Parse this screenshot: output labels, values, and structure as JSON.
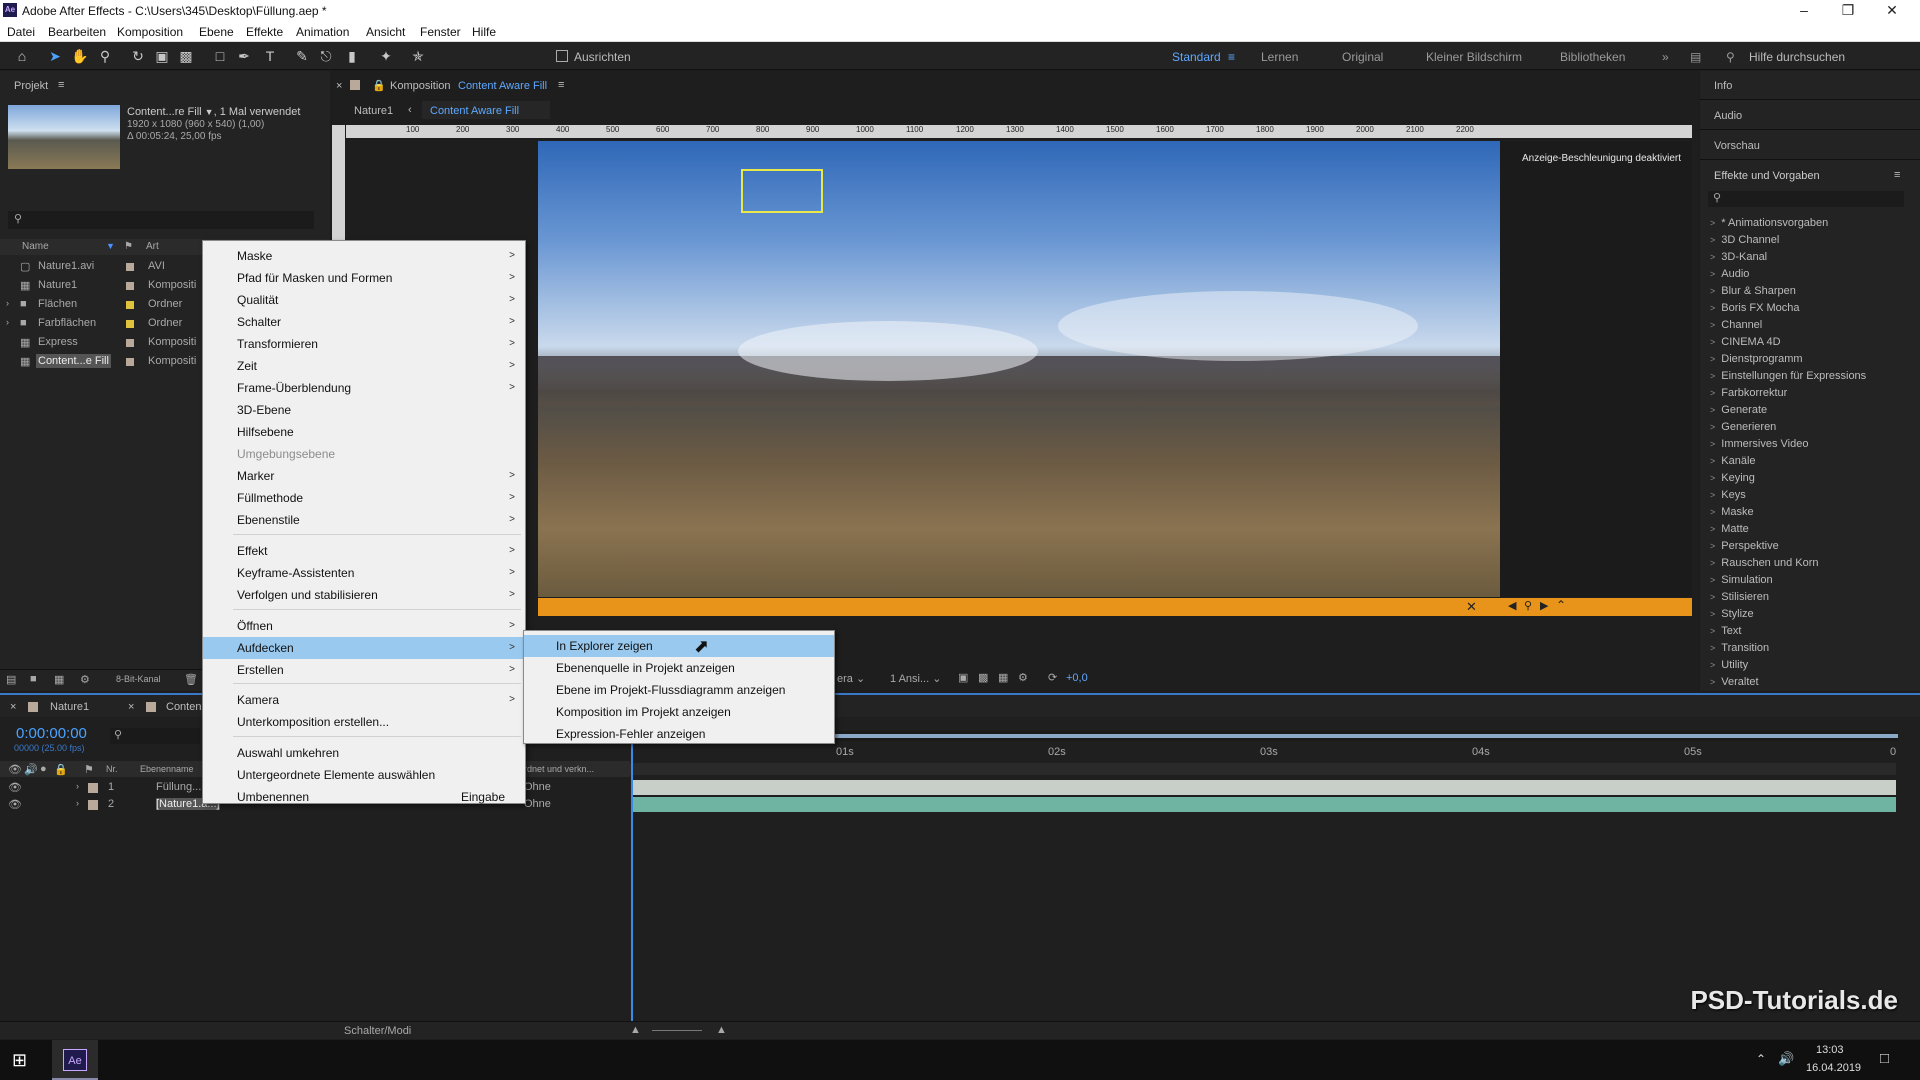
{
  "app": {
    "title": "Adobe After Effects - C:\\Users\\345\\Desktop\\Füllung.aep *",
    "logo": "Ae"
  },
  "menubar": [
    "Datei",
    "Bearbeiten",
    "Komposition",
    "Ebene",
    "Effekte",
    "Animation",
    "Ansicht",
    "Fenster",
    "Hilfe"
  ],
  "toolbar": {
    "align_label": "Ausrichten",
    "workspaces": [
      "Standard",
      "Lernen",
      "Original",
      "Kleiner Bildschirm",
      "Bibliotheken"
    ],
    "help_placeholder": "Hilfe durchsuchen"
  },
  "project": {
    "title": "Projekt",
    "item_name": "Content...re Fill",
    "item_used": ", 1 Mal verwendet",
    "item_info1": "1920 x 1080 (960 x 540) (1,00)",
    "item_info2": "Δ 00:05:24, 25,00 fps",
    "col_name": "Name",
    "col_type": "Art",
    "items": [
      {
        "name": "Nature1.avi",
        "type": "AVI",
        "color": "#b9a99a"
      },
      {
        "name": "Nature1",
        "type": "Kompositi",
        "color": "#b9a99a"
      },
      {
        "name": "Flächen",
        "type": "Ordner",
        "color": "#e0c33c"
      },
      {
        "name": "Farbflächen",
        "type": "Ordner",
        "color": "#e0c33c"
      },
      {
        "name": "Express",
        "type": "Kompositi",
        "color": "#b9a99a"
      },
      {
        "name": "Content...e Fill",
        "type": "Kompositi",
        "color": "#b9a99a"
      }
    ],
    "bitdepth": "8-Bit-Kanal"
  },
  "composition": {
    "panel_label": "Komposition",
    "panel_name": "Content Aware Fill",
    "breadcrumb": [
      "Nature1",
      "Content Aware Fill"
    ],
    "accel_msg": "Anzeige-Beschleunigung deaktiviert",
    "ruler": [
      "100",
      "200",
      "300",
      "400",
      "500",
      "600",
      "700",
      "800",
      "900",
      "1000",
      "1100",
      "1200",
      "1300",
      "1400",
      "1500",
      "1600",
      "1700",
      "1800",
      "1900",
      "2000",
      "2100",
      "2200"
    ],
    "camera_label": "era",
    "views_label": "1 Ansi...",
    "exposure": "+0,0"
  },
  "context_menu": {
    "items": [
      {
        "label": "Maske",
        "sub": true
      },
      {
        "label": "Pfad für Masken und Formen",
        "sub": true
      },
      {
        "label": "Qualität",
        "sub": true
      },
      {
        "label": "Schalter",
        "sub": true
      },
      {
        "label": "Transformieren",
        "sub": true
      },
      {
        "label": "Zeit",
        "sub": true
      },
      {
        "label": "Frame-Überblendung",
        "sub": true
      },
      {
        "label": "3D-Ebene"
      },
      {
        "label": "Hilfsebene"
      },
      {
        "label": "Umgebungsebene",
        "disabled": true
      },
      {
        "label": "Marker",
        "sub": true
      },
      {
        "label": "Füllmethode",
        "sub": true
      },
      {
        "label": "Ebenenstile",
        "sub": true
      },
      {
        "label": "Effekt",
        "sub": true
      },
      {
        "label": "Keyframe-Assistenten",
        "sub": true
      },
      {
        "label": "Verfolgen und stabilisieren",
        "sub": true
      },
      {
        "label": "Öffnen",
        "sub": true
      },
      {
        "label": "Aufdecken",
        "sub": true,
        "highlight": true
      },
      {
        "label": "Erstellen",
        "sub": true
      },
      {
        "label": "Kamera",
        "sub": true
      },
      {
        "label": "Unterkomposition erstellen..."
      },
      {
        "label": "Auswahl umkehren"
      },
      {
        "label": "Untergeordnete Elemente auswählen"
      },
      {
        "label": "Umbenennen",
        "shortcut": "Eingabe"
      }
    ]
  },
  "submenu": {
    "items": [
      {
        "label": "In Explorer zeigen",
        "highlight": true
      },
      {
        "label": "Ebenenquelle in Projekt anzeigen"
      },
      {
        "label": "Ebene im Projekt-Flussdiagramm anzeigen"
      },
      {
        "label": "Komposition im Projekt anzeigen"
      },
      {
        "label": "Expression-Fehler anzeigen"
      }
    ]
  },
  "right": {
    "panels": [
      "Info",
      "Audio",
      "Vorschau"
    ],
    "effects_title": "Effekte und Vorgaben",
    "effects": [
      "* Animationsvorgaben",
      "3D Channel",
      "3D-Kanal",
      "Audio",
      "Blur & Sharpen",
      "Boris FX Mocha",
      "Channel",
      "CINEMA 4D",
      "Dienstprogramm",
      "Einstellungen für Expressions",
      "Farbkorrektur",
      "Generate",
      "Generieren",
      "Immersives Video",
      "Kanäle",
      "Keying",
      "Keys",
      "Maske",
      "Matte",
      "Perspektive",
      "Rauschen und Korn",
      "Simulation",
      "Stilisieren",
      "Stylize",
      "Text",
      "Transition",
      "Utility",
      "Veraltet"
    ]
  },
  "timeline": {
    "tabs": [
      "Nature1",
      "Conten"
    ],
    "timecode": "0:00:00:00",
    "timecode_sub": "00000 (25.00 fps)",
    "col_nr": "Nr.",
    "col_name": "Ebenenname",
    "col_parent": "rdnet und verkn...",
    "layers": [
      {
        "nr": "1",
        "name": "Füllung...",
        "parent": "Ohne"
      },
      {
        "nr": "2",
        "name": "[Nature1.a...]",
        "parent": "Ohne"
      }
    ],
    "time_marks": [
      "01s",
      "02s",
      "03s",
      "04s",
      "05s"
    ],
    "end_mark": "0",
    "footer": "Schalter/Modi"
  },
  "taskbar": {
    "time": "13:03",
    "date": "16.04.2019",
    "watermark": "PSD-Tutorials.de"
  }
}
